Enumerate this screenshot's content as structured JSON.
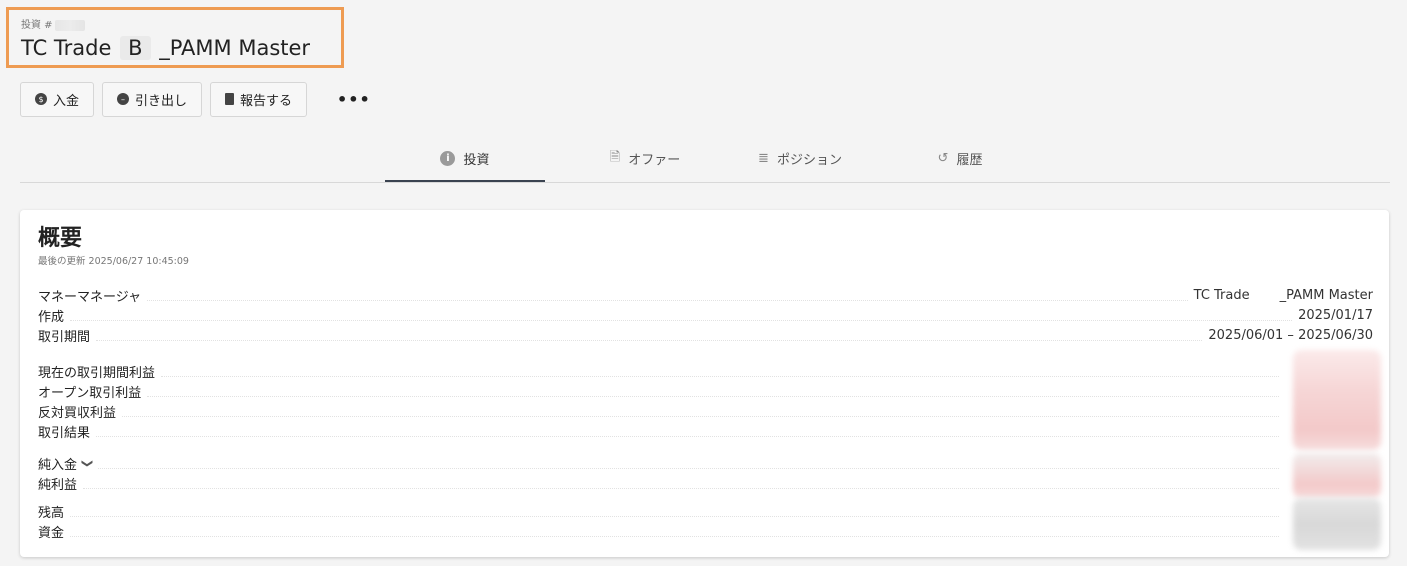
{
  "header": {
    "investment_label": "投資 #",
    "title_left": "TC Trade",
    "title_middle": "B",
    "title_right": "_PAMM Master"
  },
  "actions": [
    {
      "label": "入金",
      "icon": "dollar-circle-icon"
    },
    {
      "label": "引き出し",
      "icon": "minus-circle-icon"
    },
    {
      "label": "報告する",
      "icon": "document-icon"
    }
  ],
  "more_label": "•••",
  "tabs": [
    {
      "label": "投資",
      "icon": "info-icon",
      "active": true
    },
    {
      "label": "オファー",
      "icon": "document-dollar-icon",
      "active": false
    },
    {
      "label": "ポジション",
      "icon": "document-lines-icon",
      "active": false
    },
    {
      "label": "履歴",
      "icon": "history-icon",
      "active": false
    }
  ],
  "overview": {
    "title": "概要",
    "updated": "最後の更新 2025/06/27 10:45:09",
    "rows": {
      "money_manager": {
        "label": "マネーマネージャ",
        "value_left": "TC Trade",
        "value_right": "_PAMM Master"
      },
      "created": {
        "label": "作成",
        "value": "2025/01/17"
      },
      "period": {
        "label": "取引期間",
        "value": "2025/06/01 – 2025/06/30"
      },
      "current_profit": {
        "label": "現在の取引期間利益"
      },
      "open_profit": {
        "label": "オープン取引利益"
      },
      "closed_profit": {
        "label": "反対買収利益"
      },
      "result": {
        "label": "取引結果"
      },
      "net_deposit": {
        "label": "純入金"
      },
      "net_profit": {
        "label": "純利益"
      },
      "balance": {
        "label": "残高"
      },
      "funds": {
        "label": "資金"
      }
    }
  },
  "colors": {
    "accent_border": "#ee9b52",
    "tab_active": "#3a4350",
    "blur_red": "#f3c9c9",
    "blur_gray": "#dcdcdc"
  }
}
